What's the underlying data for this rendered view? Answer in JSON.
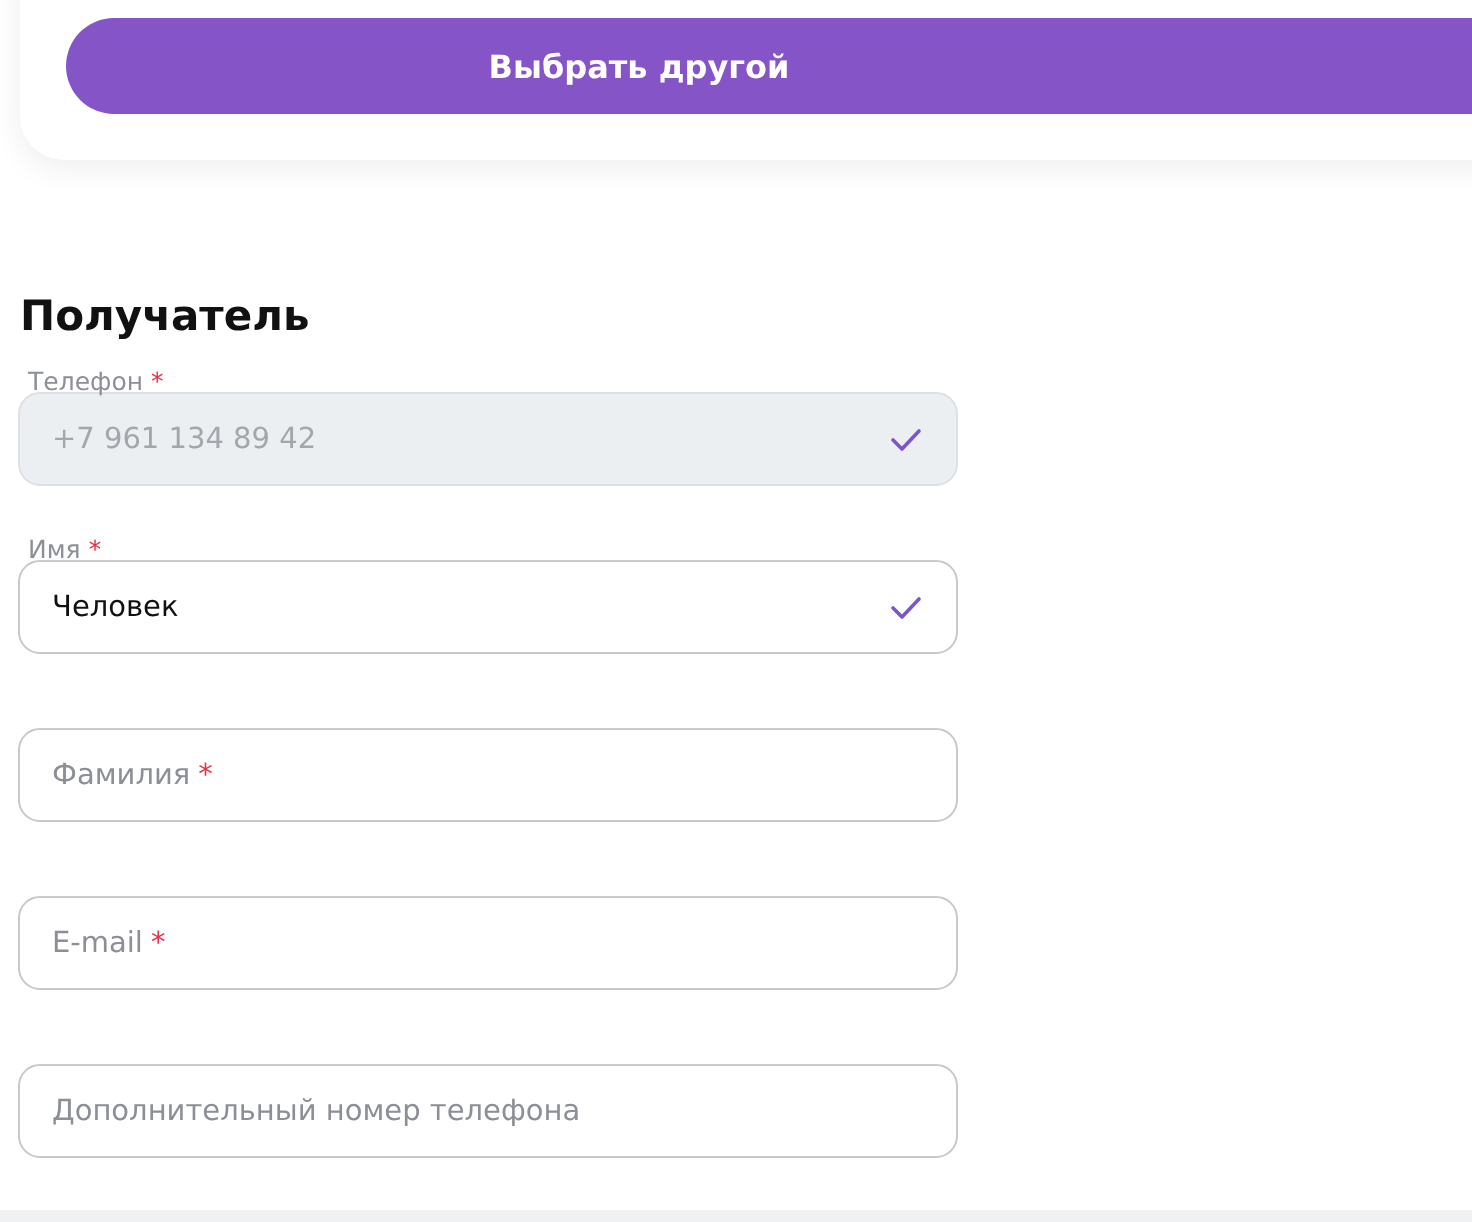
{
  "card": {
    "button": "Выбрать другой"
  },
  "recipient": {
    "title": "Получатель",
    "fields": [
      {
        "label": "Телефон",
        "required_mark": "*",
        "value": "+7 961 134 89 42",
        "disabled": true,
        "valid": true
      },
      {
        "label": "Имя",
        "required_mark": "*",
        "value": "Человек",
        "disabled": false,
        "valid": true
      },
      {
        "placeholder": "Фамилия",
        "required_mark": "*",
        "disabled": false,
        "valid": false
      },
      {
        "placeholder": "E-mail",
        "required_mark": "*",
        "disabled": false,
        "valid": false
      },
      {
        "placeholder": "Дополнительный номер телефона",
        "disabled": false,
        "valid": false
      }
    ]
  }
}
